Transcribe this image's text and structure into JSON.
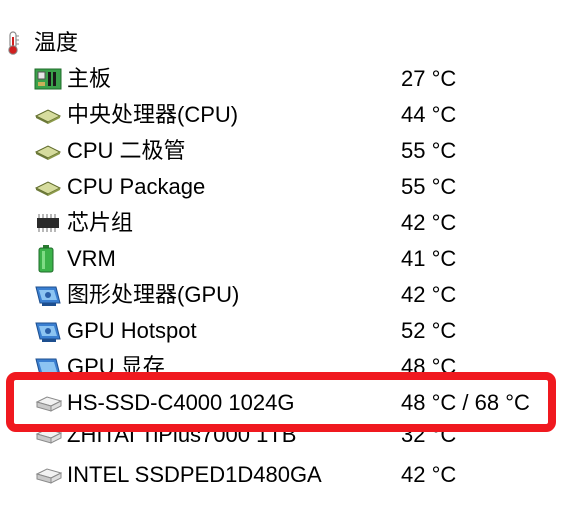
{
  "section": {
    "title": "温度",
    "icon": "thermometer-icon"
  },
  "rows": [
    {
      "label": "主板",
      "value": "27 °C",
      "icon": "motherboard-icon"
    },
    {
      "label": "中央处理器(CPU)",
      "value": "44 °C",
      "icon": "cpu-chip-icon"
    },
    {
      "label": "CPU 二极管",
      "value": "55 °C",
      "icon": "cpu-chip-icon"
    },
    {
      "label": "CPU Package",
      "value": "55 °C",
      "icon": "cpu-chip-icon"
    },
    {
      "label": "芯片组",
      "value": "42 °C",
      "icon": "chipset-icon"
    },
    {
      "label": "VRM",
      "value": "41 °C",
      "icon": "battery-icon"
    },
    {
      "label": "图形处理器(GPU)",
      "value": "42 °C",
      "icon": "gpu-card-icon"
    },
    {
      "label": "GPU Hotspot",
      "value": "52 °C",
      "icon": "gpu-card-icon"
    },
    {
      "label": "GPU 显存",
      "value": "48 °C",
      "icon": "gpu-card-icon"
    },
    {
      "label": "HS-SSD-C4000 1024G",
      "value": "48 °C / 68 °C",
      "icon": "drive-icon"
    },
    {
      "label": "ZHITAI TiPlus7000 1TB",
      "value": "32 °C",
      "icon": "drive-icon"
    },
    {
      "label": "INTEL SSDPED1D480GA",
      "value": "42 °C",
      "icon": "drive-icon"
    }
  ],
  "colors": {
    "highlight": "#f0191f",
    "accent_green": "#2aa23a",
    "gpu_blue": "#3a7fd1"
  }
}
